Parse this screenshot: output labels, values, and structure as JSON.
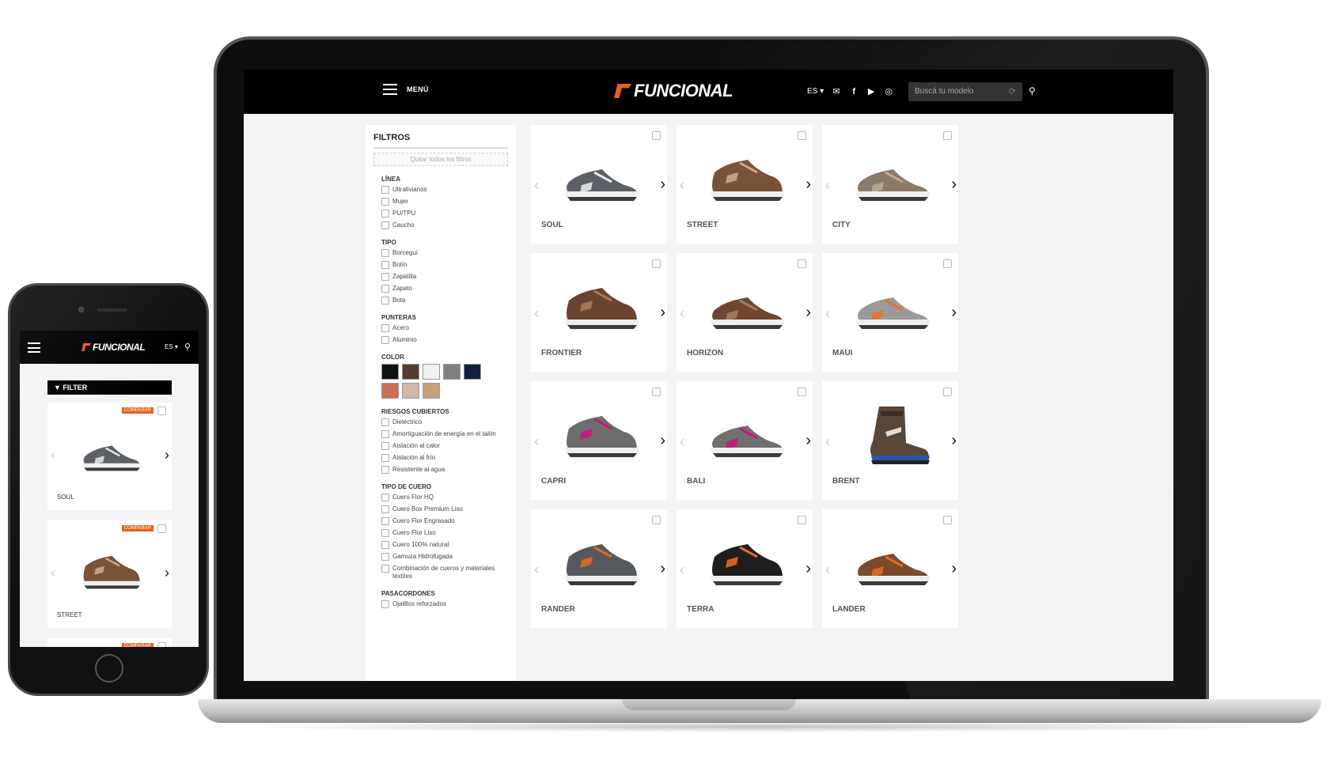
{
  "site": {
    "menu_label": "MENÚ",
    "brand": "FUNCIONAL",
    "language": "ES",
    "search_placeholder": "Buscá tu modelo"
  },
  "filters": {
    "title": "FILTROS",
    "clear_label": "Quitar todos los filtros",
    "groups": [
      {
        "title": "LÍNEA",
        "options": [
          "Ultralivianos",
          "Mujer",
          "PU/TPU",
          "Caucho"
        ]
      },
      {
        "title": "TIPO",
        "options": [
          "Borceguí",
          "Botín",
          "Zapatilla",
          "Zapato",
          "Bota"
        ]
      },
      {
        "title": "PUNTERAS",
        "options": [
          "Acero",
          "Aluminio"
        ]
      },
      {
        "title": "COLOR",
        "swatches": [
          "#111111",
          "#5a3a2c",
          "#f0f0f0",
          "#808080",
          "#14213d",
          "#c86f55",
          "#d4b5a8",
          "#c7a27a"
        ]
      },
      {
        "title": "RIESGOS CUBIERTOS",
        "options": [
          "Dieléctrico",
          "Amortiguación de energía en el talón",
          "Aislación al calor",
          "Aislación al frío",
          "Resistente al agua"
        ]
      },
      {
        "title": "TIPO DE CUERO",
        "options": [
          "Cuero Flor HQ",
          "Cuero Box Premium Liso",
          "Cuero Flor Engrasado",
          "Cuero Flor Liso",
          "Cuero 100% natural",
          "Gamuza Hidrofugada",
          "Combinación de cueros y materiales textiles"
        ]
      },
      {
        "title": "PASACORDONES",
        "options": [
          "Ojalillos reforzados"
        ]
      }
    ]
  },
  "products": [
    {
      "name": "SOUL",
      "color": "#5d5f66",
      "accent": "#e5e5e5",
      "style": "low"
    },
    {
      "name": "STREET",
      "color": "#7a5238",
      "accent": "#c9a98b",
      "style": "mid"
    },
    {
      "name": "CITY",
      "color": "#8b7a67",
      "accent": "#bda98f",
      "style": "low"
    },
    {
      "name": "FRONTIER",
      "color": "#6b4330",
      "accent": "#a77a5c",
      "style": "mid"
    },
    {
      "name": "HORIZON",
      "color": "#6e4631",
      "accent": "#a67c5e",
      "style": "low"
    },
    {
      "name": "MAUI",
      "color": "#9a9a9a",
      "accent": "#e8732f",
      "style": "low"
    },
    {
      "name": "CAPRI",
      "color": "#6d6d6d",
      "accent": "#c2187d",
      "style": "mid"
    },
    {
      "name": "BALI",
      "color": "#707070",
      "accent": "#c2187d",
      "style": "low"
    },
    {
      "name": "BRENT",
      "color": "#5a4636",
      "accent": "#2b56a8",
      "style": "boot"
    },
    {
      "name": "RANDER",
      "color": "#55585c",
      "accent": "#e36c1f",
      "style": "mid"
    },
    {
      "name": "TERRA",
      "color": "#1e1e1e",
      "accent": "#e36c1f",
      "style": "mid"
    },
    {
      "name": "LANDER",
      "color": "#7a4a2a",
      "accent": "#e36c1f",
      "style": "low"
    }
  ],
  "mobile": {
    "brand": "FUNCIONAL",
    "language": "ES",
    "filter_label": "FILTER",
    "compare_label": "COMPARAR",
    "products": [
      {
        "name": "SOUL",
        "color": "#5d5f66",
        "accent": "#e5e5e5",
        "style": "low"
      },
      {
        "name": "STREET",
        "color": "#7a5238",
        "accent": "#c9a98b",
        "style": "mid"
      },
      {
        "name": "",
        "color": "#888888",
        "accent": "#cccccc",
        "style": "low"
      }
    ]
  }
}
